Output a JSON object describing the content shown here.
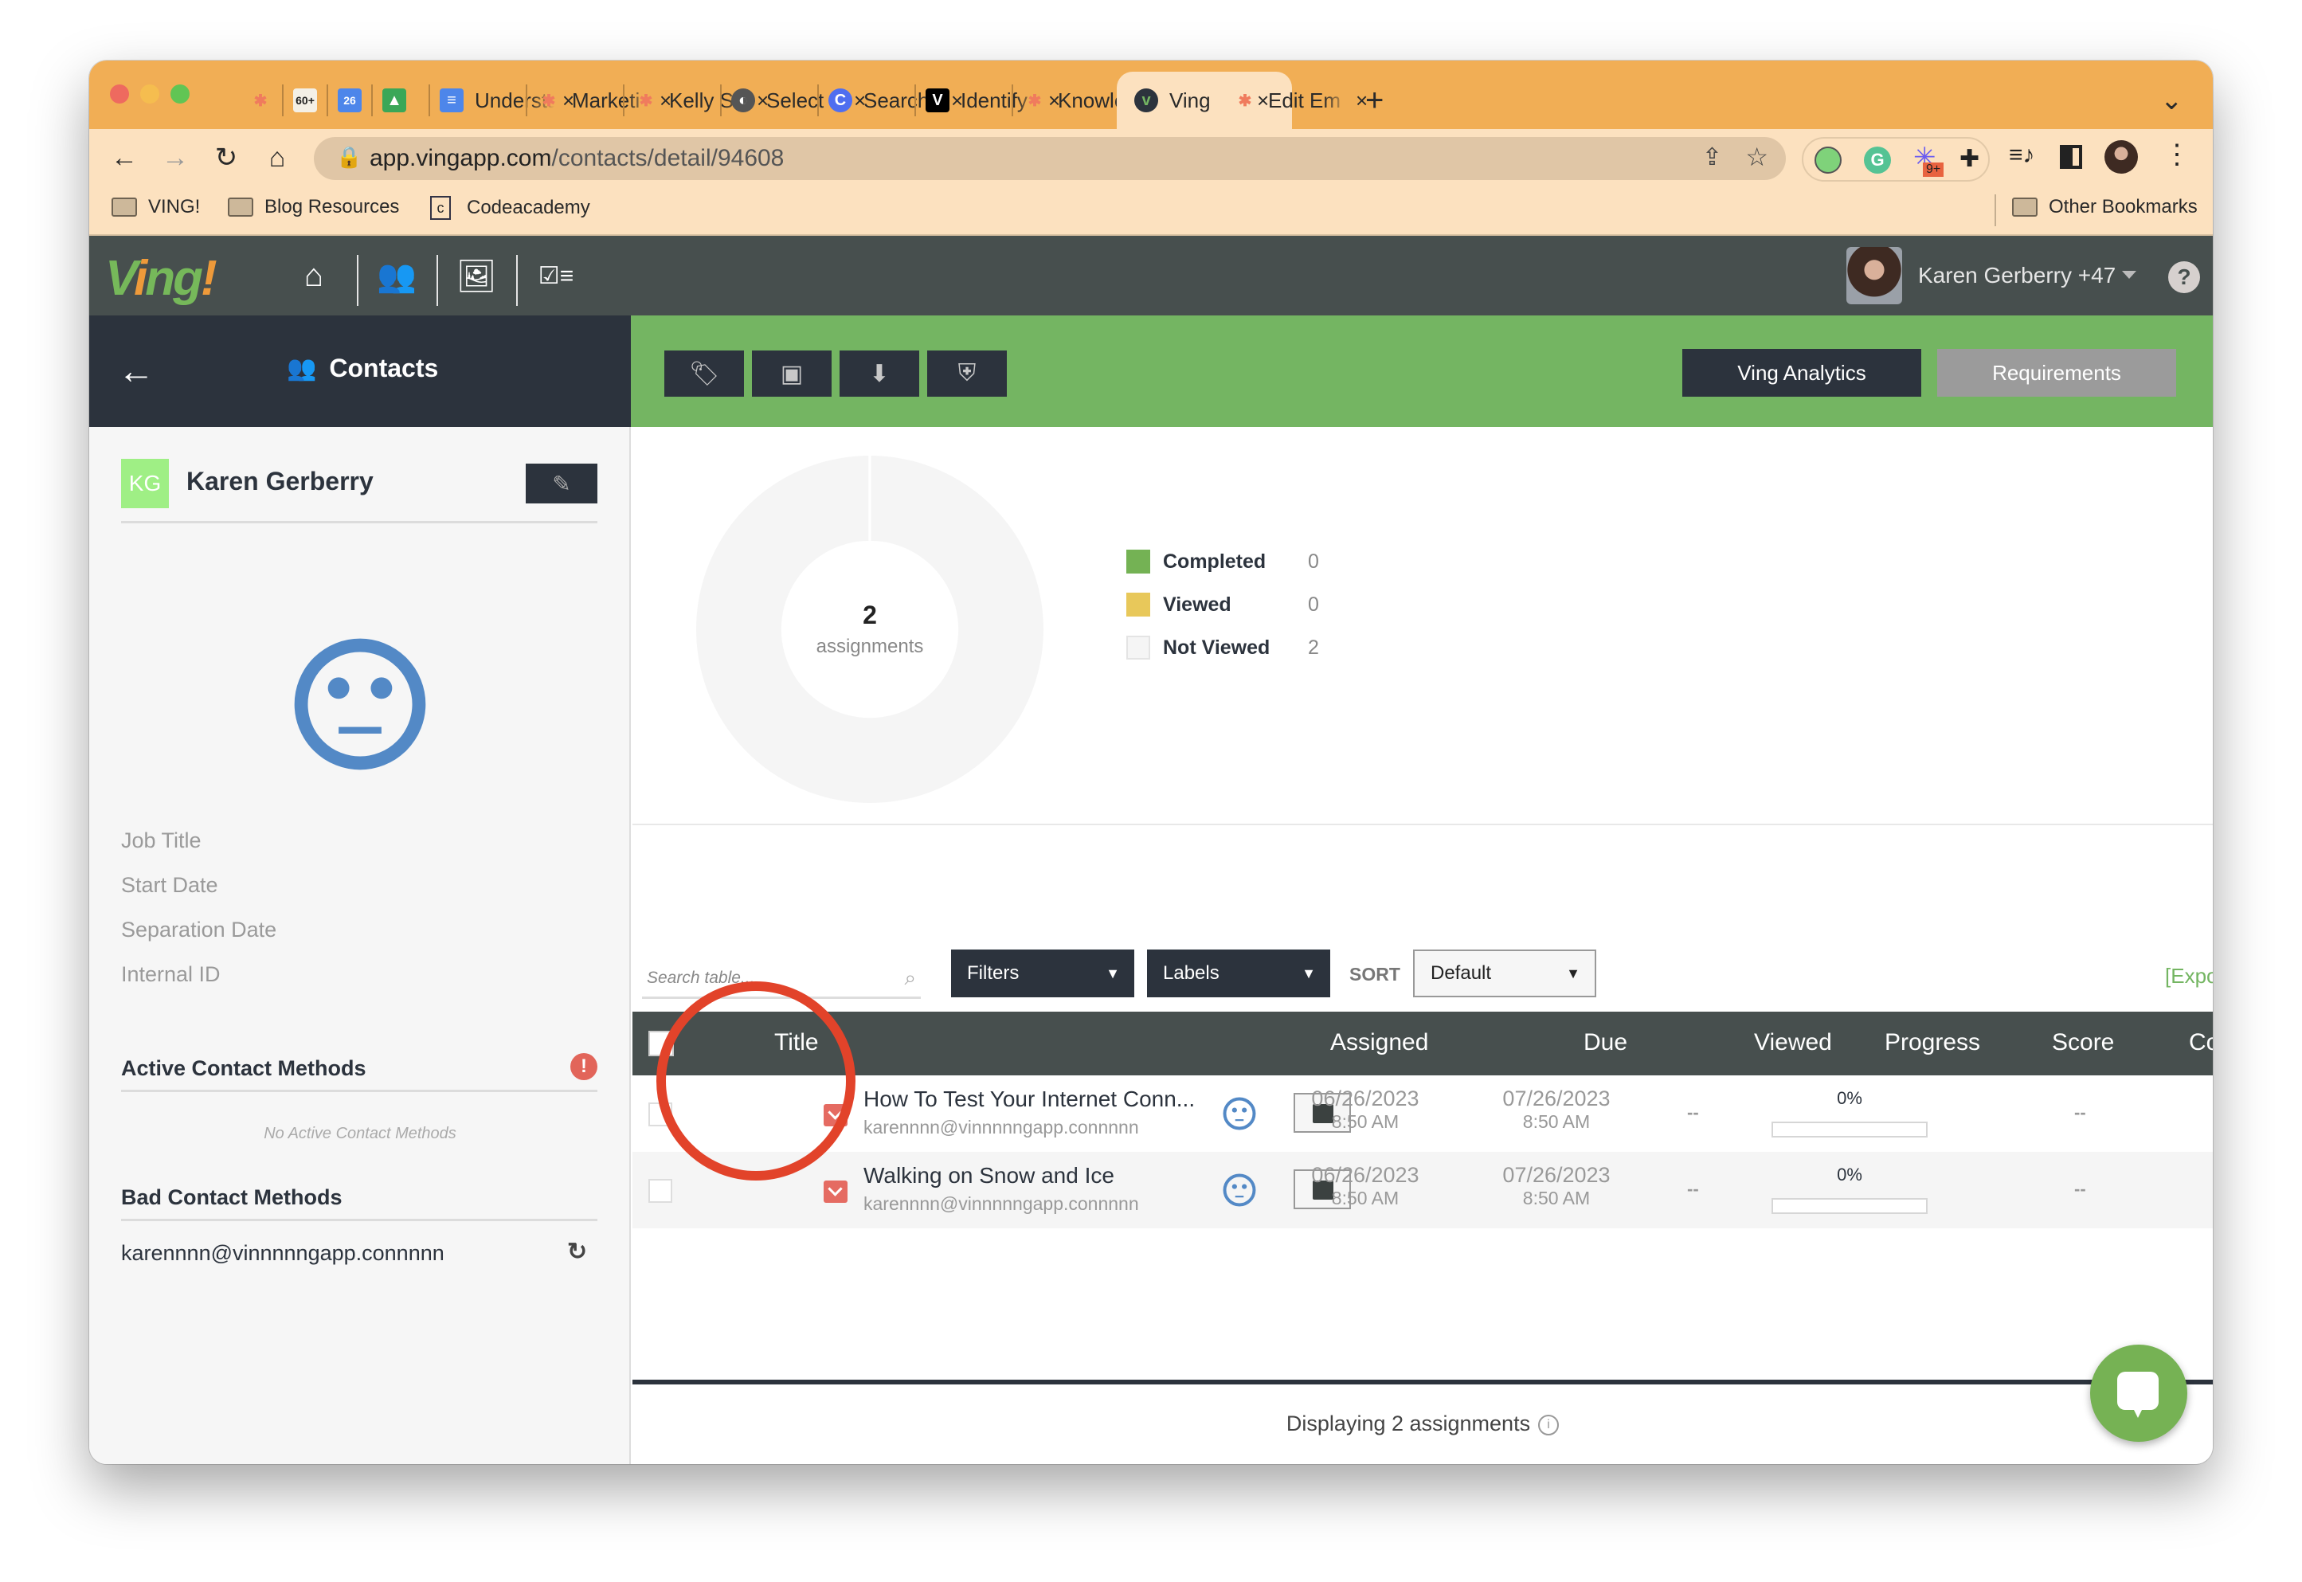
{
  "browser": {
    "tabs": [
      {
        "label": "",
        "icon": "hubspot-icon"
      },
      {
        "label": "",
        "icon": "gmail-icon",
        "badge": "60+"
      },
      {
        "label": "",
        "icon": "calendar-icon",
        "badge": "26"
      },
      {
        "label": "",
        "icon": "drive-icon"
      },
      {
        "label": "Understa",
        "icon": "docs-icon"
      },
      {
        "label": "Marketi",
        "icon": "hubspot-icon"
      },
      {
        "label": "Kelly Si",
        "icon": "hubspot-icon"
      },
      {
        "label": "Select u",
        "icon": "globe-icon"
      },
      {
        "label": "Search",
        "icon": "canva-icon"
      },
      {
        "label": "Identify",
        "icon": "v-icon"
      },
      {
        "label": "Knowle",
        "icon": "hubspot-icon"
      },
      {
        "label": "Ving",
        "icon": "ving-icon",
        "active": true
      },
      {
        "label": "Edit Em",
        "icon": "hubspot-icon"
      }
    ],
    "close_glyph": "×",
    "new_tab_glyph": "+",
    "url_host": "app.vingapp.com",
    "url_path": "/contacts/detail/94608",
    "extension_badge": "9+",
    "bookmarks": [
      {
        "label": "VING!",
        "icon": "folder-icon"
      },
      {
        "label": "Blog Resources",
        "icon": "folder-icon"
      },
      {
        "label": "Codeacademy",
        "icon": "codecademy-icon"
      }
    ],
    "other_bookmarks": "Other Bookmarks"
  },
  "app": {
    "logo_text": "Ving!",
    "user_name": "Karen Gerberry +47",
    "help_glyph": "?",
    "breadcrumb": "Contacts",
    "actions": {
      "analytics": "Ving Analytics",
      "requirements": "Requirements"
    }
  },
  "contact": {
    "initials": "KG",
    "name": "Karen Gerberry",
    "fields": [
      "Job Title",
      "Start Date",
      "Separation Date",
      "Internal ID"
    ],
    "active_methods_title": "Active Contact Methods",
    "active_methods_empty": "No Active Contact Methods",
    "bad_methods_title": "Bad Contact Methods",
    "bad_email": "karennnn@vinnnnngapp.connnnn"
  },
  "chart_data": {
    "type": "pie",
    "center_value": "2",
    "center_label": "assignments",
    "categories": [
      "Completed",
      "Viewed",
      "Not Viewed"
    ],
    "values": [
      0,
      0,
      2
    ],
    "colors": [
      "#74b254",
      "#e8c85a",
      "#f5f5f5"
    ],
    "legend": "right"
  },
  "table": {
    "search_placeholder": "Search table...",
    "filters_label": "Filters",
    "labels_label": "Labels",
    "sort_label": "SORT",
    "sort_value": "Default",
    "export_label": "[Export",
    "columns": [
      "Title",
      "Assigned",
      "Due",
      "Viewed",
      "Progress",
      "Score",
      "Completed"
    ],
    "rows": [
      {
        "title": "How To Test Your Internet Conn...",
        "email": "karennnn@vinnnnngapp.connnnn",
        "assigned_date": "06/26/2023",
        "assigned_time": "8:50 AM",
        "due_date": "07/26/2023",
        "due_time": "8:50 AM",
        "viewed": "--",
        "progress_label": "0%",
        "progress": 0,
        "score": "--",
        "completed": ""
      },
      {
        "title": "Walking on Snow and Ice",
        "email": "karennnn@vinnnnngapp.connnnn",
        "assigned_date": "06/26/2023",
        "assigned_time": "8:50 AM",
        "due_date": "07/26/2023",
        "due_time": "8:50 AM",
        "viewed": "--",
        "progress_label": "0%",
        "progress": 0,
        "score": "--",
        "completed": ""
      }
    ],
    "footer": "Displaying 2 assignments"
  },
  "colors": {
    "brand_green": "#74b562",
    "dark": "#2c333d",
    "alert_red": "#e2655a",
    "face_blue": "#5389c6"
  }
}
